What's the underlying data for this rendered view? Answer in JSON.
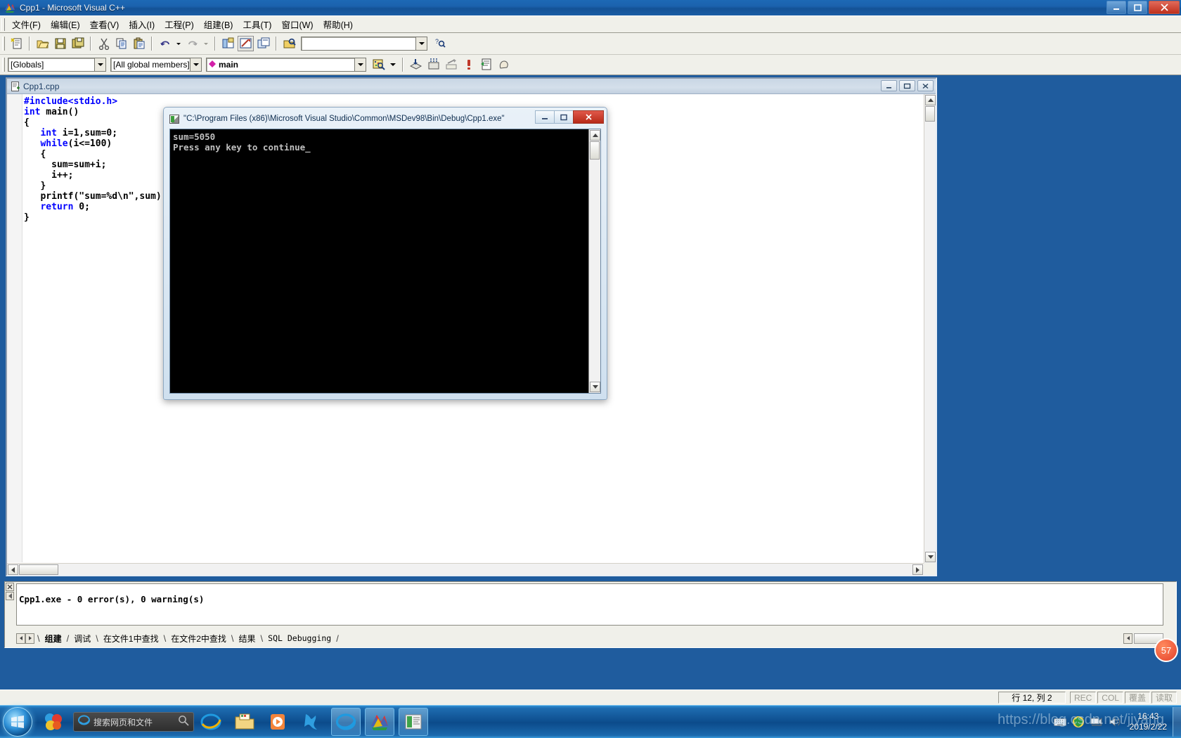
{
  "app": {
    "title": "Cpp1 - Microsoft Visual C++",
    "icon": "vcpp-icon",
    "window_buttons": {
      "minimize": "minimize-icon",
      "maximize": "maximize-icon",
      "close": "close-icon"
    }
  },
  "menubar": {
    "items": [
      {
        "label": "文件(F)",
        "name": "menu-file"
      },
      {
        "label": "编辑(E)",
        "name": "menu-edit"
      },
      {
        "label": "查看(V)",
        "name": "menu-view"
      },
      {
        "label": "插入(I)",
        "name": "menu-insert"
      },
      {
        "label": "工程(P)",
        "name": "menu-project"
      },
      {
        "label": "组建(B)",
        "name": "menu-build"
      },
      {
        "label": "工具(T)",
        "name": "menu-tools"
      },
      {
        "label": "窗口(W)",
        "name": "menu-window"
      },
      {
        "label": "帮助(H)",
        "name": "menu-help"
      }
    ]
  },
  "toolbar_standard": {
    "buttons": [
      "new-text-file-icon",
      "open-icon",
      "save-icon",
      "save-all-icon",
      "cut-icon",
      "copy-icon",
      "paste-icon",
      "undo-icon",
      "redo-icon",
      "workspace-icon",
      "output-icon",
      "window-list-icon",
      "find-in-files-icon"
    ],
    "find_box_value": "",
    "find_box_placeholder": "",
    "help_button": "find-help-icon"
  },
  "toolbar_wizardbar": {
    "class_combo": {
      "value": "[Globals]",
      "name": "class-combo"
    },
    "filter_combo": {
      "value": "[All global members]",
      "name": "members-combo"
    },
    "member_combo": {
      "value": "main",
      "name": "function-combo",
      "icon": "member-diamond-icon"
    },
    "action_button": "wizard-action-icon",
    "build_buttons": [
      "compile-icon",
      "build-icon",
      "stop-build-icon",
      "execute-icon",
      "go-icon",
      "insert-breakpoint-icon"
    ]
  },
  "mdi_window": {
    "title": "Cpp1.cpp",
    "icon": "cpp-file-icon",
    "buttons": {
      "minimize": "minimize-icon",
      "restore": "restore-icon",
      "close": "close-icon"
    }
  },
  "editor": {
    "lines": [
      {
        "parts": [
          {
            "t": "#include<stdio.h>",
            "c": "pp"
          }
        ],
        "indent": 0
      },
      {
        "parts": [
          {
            "t": "int",
            "c": "kw"
          },
          {
            "t": " main()",
            "c": ""
          }
        ],
        "indent": 0
      },
      {
        "parts": [
          {
            "t": "{",
            "c": ""
          }
        ],
        "indent": 0
      },
      {
        "parts": [
          {
            "t": "int",
            "c": "kw"
          },
          {
            "t": " i=1,sum=0;",
            "c": ""
          }
        ],
        "indent": 1
      },
      {
        "parts": [
          {
            "t": "while",
            "c": "kw"
          },
          {
            "t": "(i<=100)",
            "c": ""
          }
        ],
        "indent": 1
      },
      {
        "parts": [
          {
            "t": "{",
            "c": ""
          }
        ],
        "indent": 1
      },
      {
        "parts": [
          {
            "t": "sum=sum+i;",
            "c": ""
          }
        ],
        "indent": 2
      },
      {
        "parts": [
          {
            "t": "i++;",
            "c": ""
          }
        ],
        "indent": 2
      },
      {
        "parts": [
          {
            "t": "}",
            "c": ""
          }
        ],
        "indent": 1
      },
      {
        "parts": [
          {
            "t": "printf(\"sum=%d\\n\",sum);",
            "c": ""
          }
        ],
        "indent": 1
      },
      {
        "parts": [
          {
            "t": "return",
            "c": "kw"
          },
          {
            "t": " 0;",
            "c": ""
          }
        ],
        "indent": 1
      },
      {
        "parts": [
          {
            "t": "}",
            "c": ""
          }
        ],
        "indent": 0
      }
    ],
    "plain_text": "#include<stdio.h>\nint main()\n{\n   int i=1,sum=0;\n   while(i<=100)\n   {\n     sum=sum+i;\n     i++;\n   }\n   printf(\"sum=%d\\n\",sum);\n   return 0;\n}"
  },
  "console": {
    "title": "\"C:\\Program Files (x86)\\Microsoft Visual Studio\\Common\\MSDev98\\Bin\\Debug\\Cpp1.exe\"",
    "icon": "console-icon",
    "output": "sum=5050\nPress any key to continue_",
    "buttons": {
      "minimize": "minimize-icon",
      "maximize": "maximize-icon",
      "close": "close-icon"
    }
  },
  "output_pane": {
    "close_button": "close-pane-icon",
    "dock_button": "dock-pane-icon",
    "text": "Cpp1.exe - 0 error(s), 0 warning(s)",
    "tabs": [
      {
        "label": "组建",
        "selected": true,
        "mono": false
      },
      {
        "label": "调试",
        "selected": false,
        "mono": false
      },
      {
        "label": "在文件1中查找",
        "selected": false,
        "mono": false
      },
      {
        "label": "在文件2中查找",
        "selected": false,
        "mono": false
      },
      {
        "label": "结果",
        "selected": false,
        "mono": false
      },
      {
        "label": "SQL Debugging",
        "selected": false,
        "mono": true
      }
    ]
  },
  "statusbar": {
    "position": "行 12, 列 2",
    "indicators": [
      {
        "label": "REC",
        "dim": true
      },
      {
        "label": "COL",
        "dim": true
      },
      {
        "label": "覆盖",
        "dim": true
      },
      {
        "label": "读取",
        "dim": true
      }
    ]
  },
  "taskbar": {
    "start": "windows-start-orb-icon",
    "quick_icon": "360-safe-icon",
    "search": {
      "value": "",
      "placeholder": "搜索网页和文件",
      "icon": "ie-small-icon",
      "action_icon": "search-icon"
    },
    "items": [
      {
        "name": "internet-explorer-icon",
        "pinned": false
      },
      {
        "name": "file-explorer-icon",
        "pinned": false
      },
      {
        "name": "media-player-icon",
        "pinned": false
      },
      {
        "name": "kugou-icon",
        "pinned": false
      },
      {
        "name": "ie-running-icon",
        "pinned": true
      },
      {
        "name": "visual-cpp-running-icon",
        "pinned": true
      },
      {
        "name": "console-running-icon",
        "pinned": true
      }
    ],
    "tray": [
      {
        "name": "keyboard-layout-icon"
      },
      {
        "name": "shield-update-icon"
      },
      {
        "name": "network-icon"
      },
      {
        "name": "volume-icon"
      }
    ],
    "clock_time": "16:43",
    "clock_date": "2019/2/22",
    "show_desktop": "show-desktop-button"
  },
  "watermark": {
    "text": "https://blog.csdn.net/jiyang",
    "badge": "57"
  },
  "colors": {
    "keyword": "#0000ff",
    "title_blue": "#1b62ad",
    "console_bg": "#000000",
    "console_fg": "#c0c0c0",
    "face": "#f0f0ea"
  }
}
